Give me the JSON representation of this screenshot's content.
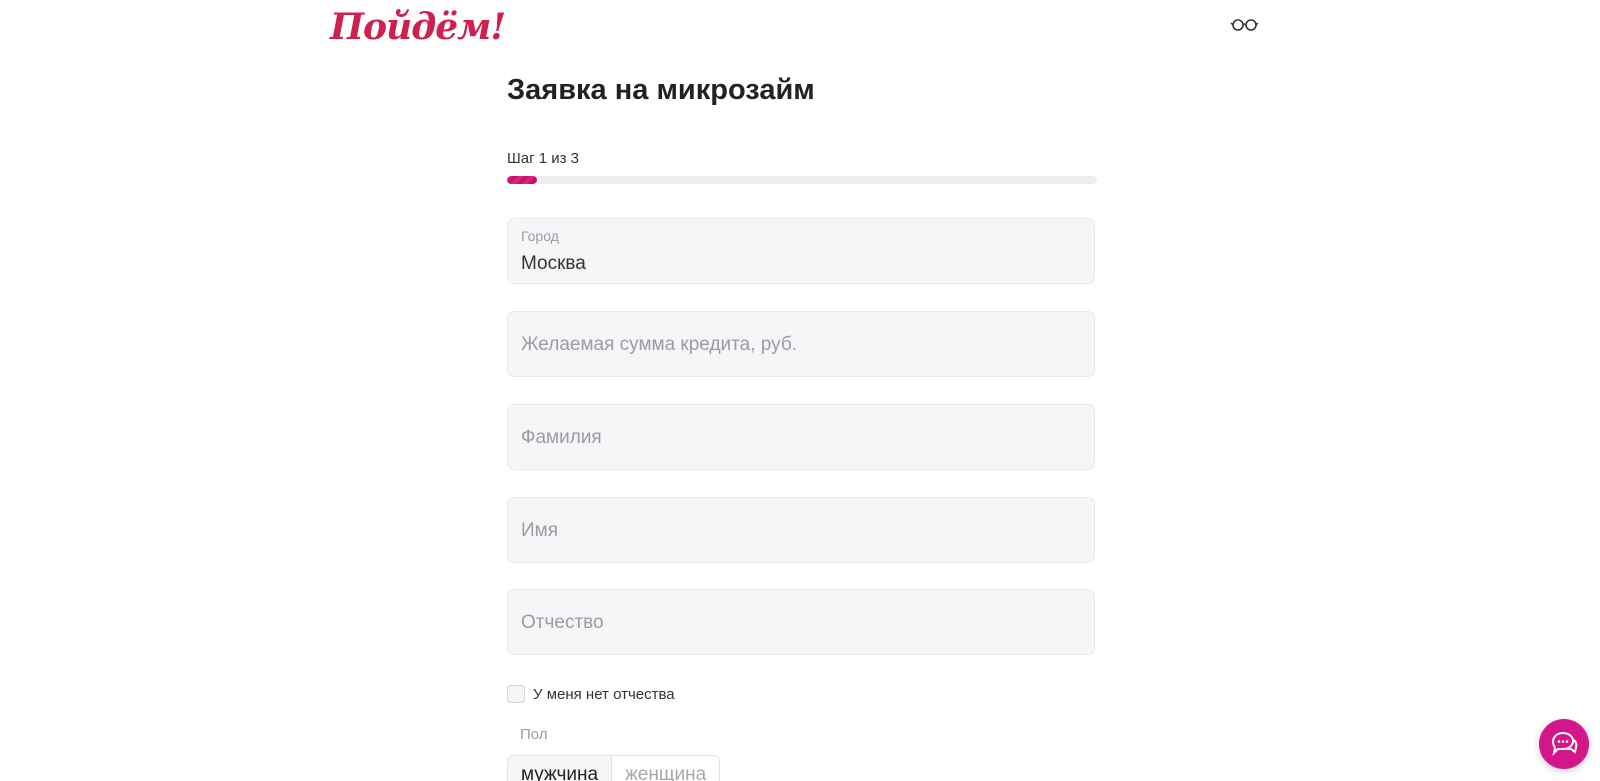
{
  "header": {
    "logo_text": "Пойдём!",
    "accessibility_icon": "glasses-icon"
  },
  "form": {
    "title": "Заявка на микрозайм",
    "step_text": "Шаг 1 из 3",
    "progress_fraction": 0.05,
    "city": {
      "label": "Город",
      "value": "Москва"
    },
    "amount": {
      "placeholder": "Желаемая сумма кредита, руб."
    },
    "last_name": {
      "placeholder": "Фамилия"
    },
    "first_name": {
      "placeholder": "Имя"
    },
    "patronymic": {
      "placeholder": "Отчество"
    },
    "no_patronymic_label": "У меня нет отчества",
    "gender": {
      "label": "Пол",
      "options": [
        "мужчина",
        "женщина"
      ],
      "selected": "мужчина"
    }
  },
  "chat": {
    "icon": "chat-icon"
  },
  "colors": {
    "brand": "#d0204f",
    "accent": "#d4168b",
    "field_bg": "#f5f6f8"
  }
}
